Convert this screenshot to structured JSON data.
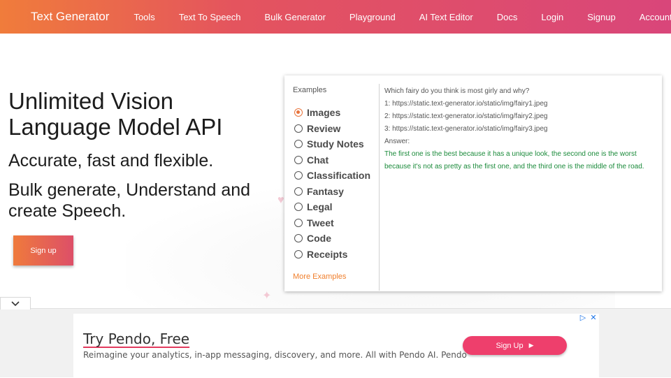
{
  "navbar": {
    "brand": "Text Generator",
    "links": [
      "Tools",
      "Text To Speech",
      "Bulk Generator",
      "Playground",
      "AI Text Editor",
      "Docs",
      "Login",
      "Signup",
      "Account"
    ]
  },
  "hero": {
    "title": "Unlimited Vision Language Model API",
    "subtitle1": "Accurate, fast and flexible.",
    "subtitle2": "Bulk generate, Understand and create Speech.",
    "signup_label": "Sign up"
  },
  "examples": {
    "label": "Examples",
    "items": [
      "Images",
      "Review",
      "Study Notes",
      "Chat",
      "Classification",
      "Fantasy",
      "Legal",
      "Tweet",
      "Code",
      "Receipts"
    ],
    "selected": "Images",
    "more_label": "More Examples"
  },
  "output": {
    "question": "Which fairy do you think is most girly and why?",
    "lines": [
      "1: https://static.text-generator.io/static/img/fairy1.jpeg",
      "2: https://static.text-generator.io/static/img/fairy2.jpeg",
      "3: https://static.text-generator.io/static/img/fairy3.jpeg"
    ],
    "answer_label": "Answer:",
    "answer": "The first one is the best because it has a unique look, the second one is the worst because it's not as pretty as the first one, and the third one is the middle of the road."
  },
  "ad": {
    "title": "Try Pendo, Free",
    "description": "Reimagine your analytics, in-app messaging, discovery, and more. All with Pendo AI. Pendo",
    "cta": "Sign Up"
  },
  "colors": {
    "accent": "#e8743c",
    "answer": "#1a8a3a",
    "ad_cta": "#ee3f6c"
  }
}
